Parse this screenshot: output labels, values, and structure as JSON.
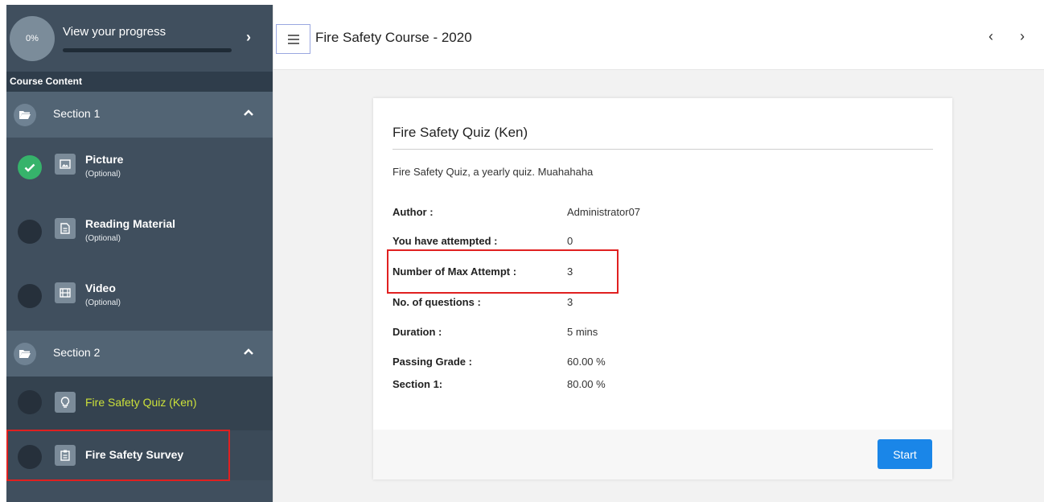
{
  "progress": {
    "percent_label": "0%",
    "title": "View your progress",
    "fraction": 0.0
  },
  "sidebar": {
    "course_content_label": "Course Content",
    "sections": [
      {
        "label": "Section 1"
      },
      {
        "label": "Section 2"
      }
    ],
    "items": [
      {
        "label": "Picture",
        "sub": "(Optional)",
        "status": "completed",
        "icon": "image-icon"
      },
      {
        "label": "Reading Material",
        "sub": "(Optional)",
        "status": "incomplete",
        "icon": "document-icon"
      },
      {
        "label": "Video",
        "sub": "(Optional)",
        "status": "incomplete",
        "icon": "film-icon"
      },
      {
        "label": "Fire Safety Quiz (Ken)",
        "status": "active",
        "icon": "lightbulb-icon"
      },
      {
        "label": "Fire Safety Survey",
        "status": "incomplete",
        "icon": "clipboard-icon"
      }
    ]
  },
  "header": {
    "title": "Fire Safety Course - 2020"
  },
  "quiz": {
    "title": "Fire Safety Quiz (Ken)",
    "description": "Fire Safety Quiz, a yearly quiz. Muahahaha",
    "rows": [
      {
        "label": "Author :",
        "value": "Administrator07"
      },
      {
        "label": "You have attempted :",
        "value": "0"
      },
      {
        "label": "Number of Max Attempt :",
        "value": "3"
      },
      {
        "label": "No. of questions :",
        "value": "3"
      },
      {
        "label": "Duration :",
        "value": "5 mins"
      },
      {
        "label": "Passing Grade :",
        "value": "60.00 %"
      },
      {
        "label": "Section 1:",
        "value": "80.00 %"
      }
    ],
    "start_label": "Start"
  },
  "colors": {
    "sidebar_bg": "#404f5e",
    "section_bg": "#526474",
    "active_text": "#cbe03a",
    "completed": "#36b36b",
    "start_button": "#1a86e8",
    "highlight": "#e02020"
  }
}
